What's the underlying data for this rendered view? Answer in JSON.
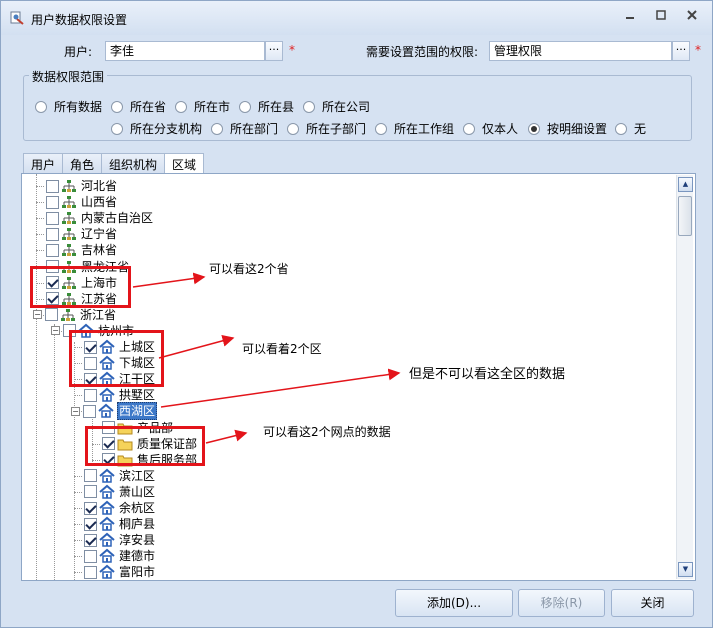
{
  "window": {
    "title": "用户数据权限设置",
    "minimize": "▭",
    "maximize": "□",
    "close": "✕"
  },
  "form": {
    "user_label": "用户:",
    "user_value": "李佳",
    "browse": "···",
    "required": "*",
    "scope_label": "需要设置范围的权限:",
    "scope_value": "管理权限"
  },
  "range": {
    "title": "数据权限范围",
    "options": [
      "所有数据",
      "所在省",
      "所在市",
      "所在县",
      "所在公司",
      "所在分支机构",
      "所在部门",
      "所在子部门",
      "所在工作组",
      "仅本人",
      "按明细设置",
      "无"
    ],
    "selected": "按明细设置"
  },
  "tabs": [
    "用户",
    "角色",
    "组织机构",
    "区域"
  ],
  "active_tab": "区域",
  "tree": [
    {
      "label": "河北省",
      "checked": false
    },
    {
      "label": "山西省",
      "checked": false
    },
    {
      "label": "内蒙古自治区",
      "checked": false
    },
    {
      "label": "辽宁省",
      "checked": false
    },
    {
      "label": "吉林省",
      "checked": false
    },
    {
      "label": "黑龙江省",
      "checked": false
    },
    {
      "label": "上海市",
      "checked": true
    },
    {
      "label": "江苏省",
      "checked": true
    },
    {
      "label": "浙江省",
      "checked": false
    },
    {
      "label": "杭州市",
      "checked": false
    },
    {
      "label": "上城区",
      "checked": true
    },
    {
      "label": "下城区",
      "checked": false
    },
    {
      "label": "江干区",
      "checked": true
    },
    {
      "label": "拱墅区",
      "checked": false
    },
    {
      "label": "西湖区",
      "checked": false
    },
    {
      "label": "产品部",
      "checked": false
    },
    {
      "label": "质量保证部",
      "checked": true
    },
    {
      "label": "售后服务部",
      "checked": true
    },
    {
      "label": "滨江区",
      "checked": false
    },
    {
      "label": "萧山区",
      "checked": false
    },
    {
      "label": "余杭区",
      "checked": true
    },
    {
      "label": "桐庐县",
      "checked": true
    },
    {
      "label": "淳安县",
      "checked": true
    },
    {
      "label": "建德市",
      "checked": false
    },
    {
      "label": "富阳市",
      "checked": false
    }
  ],
  "annotations": [
    "可以看这2个省",
    "可以看着2个区",
    "但是不可以看这全区的数据",
    "可以看这2个网点的数据"
  ],
  "buttons": {
    "add": "添加(D)...",
    "remove": "移除(R)",
    "close": "关闭"
  },
  "colors": {
    "annotation_red": "#e3141a",
    "selection_blue": "#3d78c8",
    "window_bg": "#d6e2f2"
  }
}
